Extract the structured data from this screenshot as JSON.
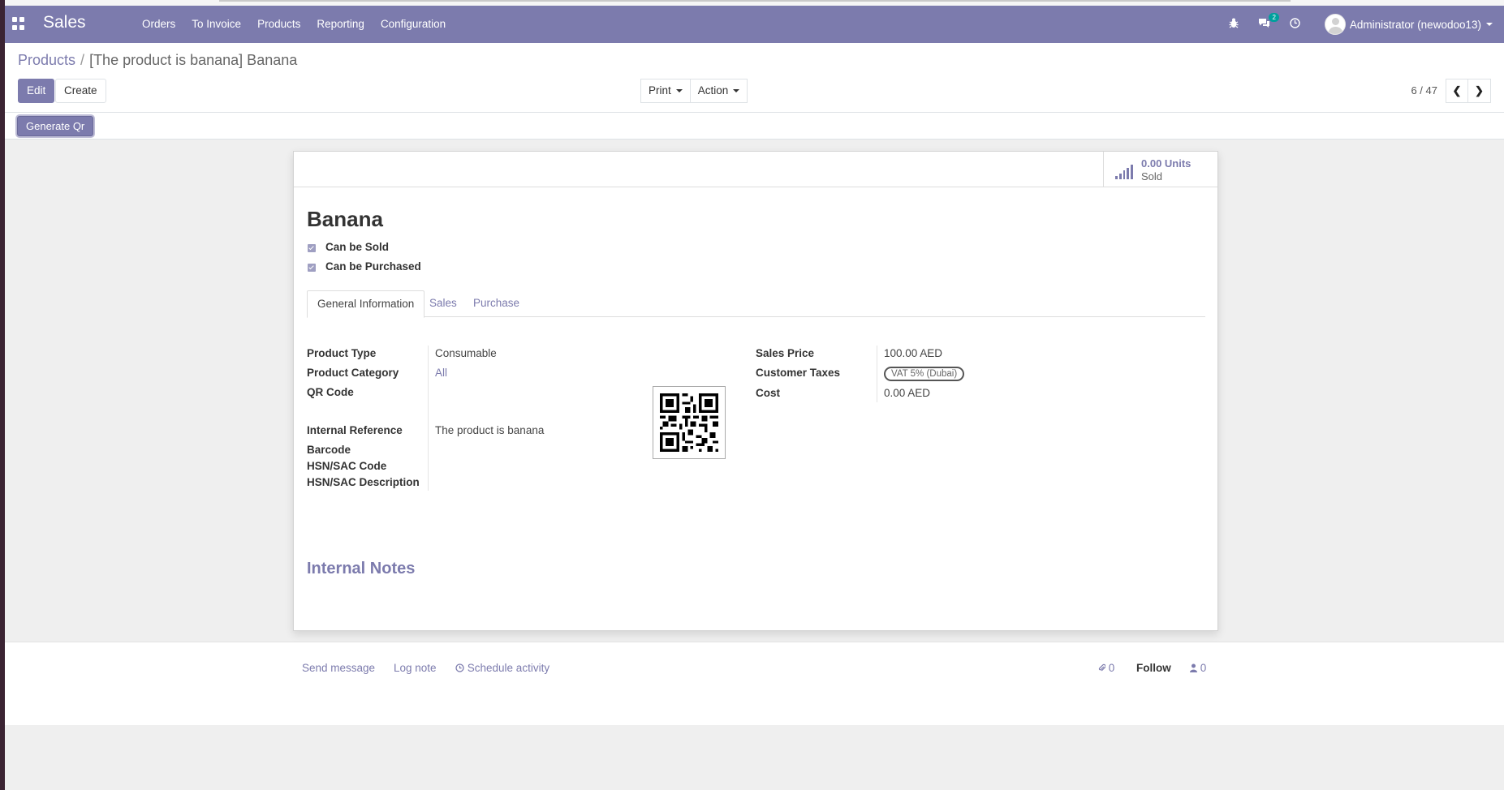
{
  "navbar": {
    "app_name": "Sales",
    "menu": [
      "Orders",
      "To Invoice",
      "Products",
      "Reporting",
      "Configuration"
    ],
    "message_count": "2",
    "user_name": "Administrator (newodoo13)"
  },
  "breadcrumb": {
    "parent": "Products",
    "separator": "/",
    "current": "[The product is banana] Banana"
  },
  "toolbar": {
    "edit_label": "Edit",
    "create_label": "Create",
    "print_label": "Print",
    "action_label": "Action",
    "pager": "6 / 47"
  },
  "header": {
    "generate_qr_label": "Generate Qr"
  },
  "stat_button": {
    "value": "0.00 Units",
    "label": "Sold"
  },
  "product": {
    "name": "Banana",
    "can_be_sold_label": "Can be Sold",
    "can_be_purchased_label": "Can be Purchased",
    "can_be_sold": true,
    "can_be_purchased": true
  },
  "tabs": [
    "General Information",
    "Sales",
    "Purchase"
  ],
  "fields": {
    "product_type": {
      "label": "Product Type",
      "value": "Consumable"
    },
    "product_category": {
      "label": "Product Category",
      "value": "All"
    },
    "qr_code": {
      "label": "QR Code"
    },
    "internal_reference": {
      "label": "Internal Reference",
      "value": "The product is banana"
    },
    "barcode": {
      "label": "Barcode",
      "value": ""
    },
    "hsn_code": {
      "label": "HSN/SAC Code",
      "value": ""
    },
    "hsn_description": {
      "label": "HSN/SAC Description",
      "value": ""
    },
    "sales_price": {
      "label": "Sales Price",
      "value": "100.00 AED"
    },
    "customer_taxes": {
      "label": "Customer Taxes",
      "value": "VAT 5% (Dubai)"
    },
    "cost": {
      "label": "Cost",
      "value": "0.00 AED"
    }
  },
  "notes": {
    "title": "Internal Notes"
  },
  "chatter": {
    "send_message": "Send message",
    "log_note": "Log note",
    "schedule_activity": "Schedule activity",
    "attachments": "0",
    "follow": "Follow",
    "followers": "0"
  },
  "colors": {
    "brand": "#7c7bad",
    "background": "#efefef"
  }
}
